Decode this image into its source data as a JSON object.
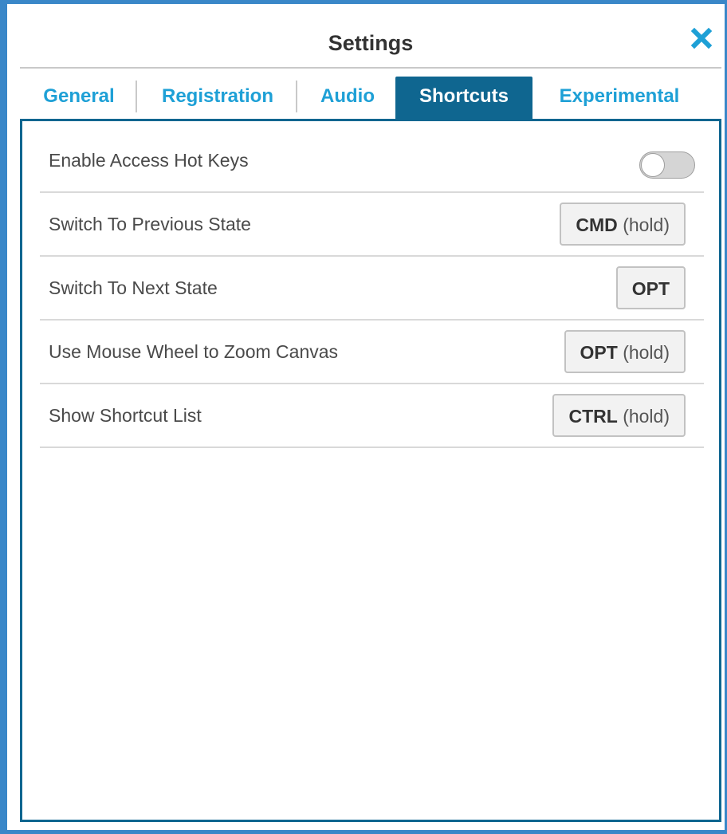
{
  "dialog": {
    "title": "Settings",
    "close_icon": "close-icon"
  },
  "tabs": [
    {
      "label": "General",
      "active": false
    },
    {
      "label": "Registration",
      "active": false
    },
    {
      "label": "Audio",
      "active": false
    },
    {
      "label": "Shortcuts",
      "active": true
    },
    {
      "label": "Experimental",
      "active": false
    }
  ],
  "shortcuts": {
    "rows": [
      {
        "label": "Enable Access Hot Keys",
        "control": "toggle",
        "enabled": false
      },
      {
        "label": "Switch To Previous State",
        "key": "CMD",
        "modifier": "(hold)"
      },
      {
        "label": "Switch To Next State",
        "key": "OPT",
        "modifier": ""
      },
      {
        "label": "Use Mouse Wheel to Zoom Canvas",
        "key": "OPT",
        "modifier": "(hold)"
      },
      {
        "label": "Show Shortcut List",
        "key": "CTRL",
        "modifier": "(hold)"
      }
    ]
  },
  "colors": {
    "accent": "#1ea0d6",
    "active_tab": "#0f6690",
    "window_border": "#3a87c8"
  }
}
